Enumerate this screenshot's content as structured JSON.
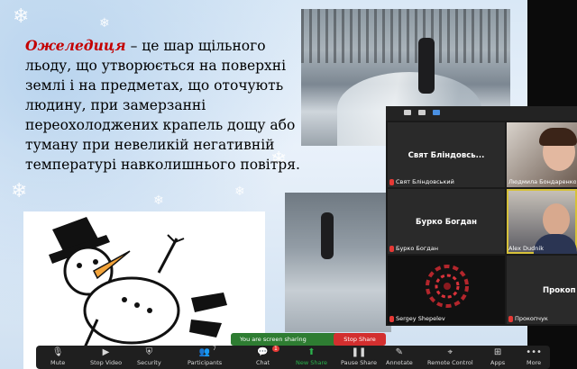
{
  "slide": {
    "term": "Ожеледиця",
    "definition": " – це шар щільного льоду, що утворюється на поверхні землі і на предметах, що оточують людину, при замерзанні переохолоджених крапель дощу або туману при невеликій негативній температурі навколишнього повітря."
  },
  "participants": [
    {
      "center_name": "Свят Бліндовсь...",
      "label": "Свят Бліндовський",
      "video": false,
      "muted": true
    },
    {
      "center_name": "",
      "label": "Людмила Бондаренко",
      "video": true,
      "muted": false
    },
    {
      "center_name": "Бурко Богдан",
      "label": "Бурко Богдан",
      "video": false,
      "muted": true
    },
    {
      "center_name": "",
      "label": "Alex Dudnik",
      "video": true,
      "muted": false
    },
    {
      "center_name": "",
      "label": "Sergey Shepelev",
      "video": true,
      "muted": true
    },
    {
      "center_name": "Прокоп",
      "label": "Прокопчук",
      "video": false,
      "muted": true
    }
  ],
  "share": {
    "banner": "You are screen sharing",
    "stop": "Stop Share"
  },
  "toolbar": {
    "mute": "Mute",
    "stop_video": "Stop Video",
    "security": "Security",
    "participants": "Participants",
    "participants_count": "7",
    "chat": "Chat",
    "chat_badge": "1",
    "new_share": "New Share",
    "pause_share": "Pause Share",
    "annotate": "Annotate",
    "remote_control": "Remote Control",
    "apps": "Apps",
    "more": "More"
  },
  "colors": {
    "term_red": "#c40000",
    "share_green": "#2e7d32",
    "stop_red": "#d32f2f",
    "toolbar_bg": "#1f1f1f"
  }
}
